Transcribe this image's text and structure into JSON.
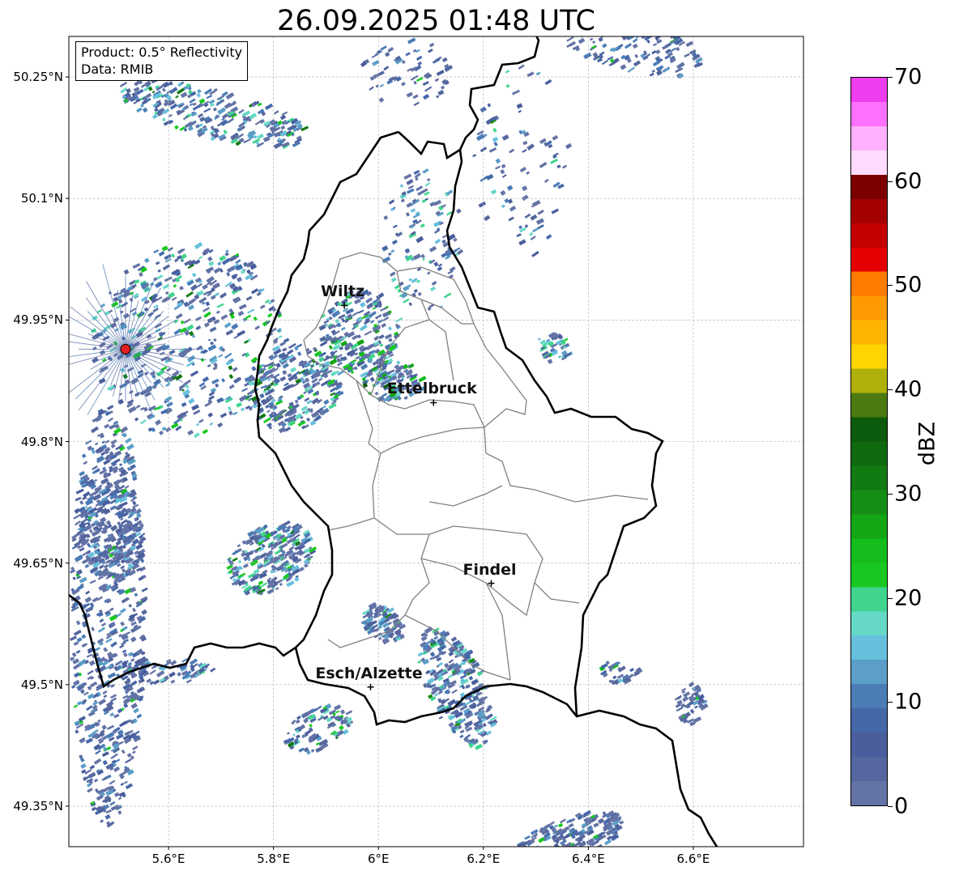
{
  "title": "26.09.2025 01:48 UTC",
  "info": {
    "product": "Product: 0.5° Reflectivity",
    "data": "Data: RMIB"
  },
  "y_ticks": [
    {
      "label": "50.25°N",
      "lat": 50.25
    },
    {
      "label": "50.1°N",
      "lat": 50.1
    },
    {
      "label": "49.95°N",
      "lat": 49.95
    },
    {
      "label": "49.8°N",
      "lat": 49.8
    },
    {
      "label": "49.65°N",
      "lat": 49.65
    },
    {
      "label": "49.5°N",
      "lat": 49.5
    },
    {
      "label": "49.35°N",
      "lat": 49.35
    }
  ],
  "x_ticks": [
    {
      "label": "5.6°E",
      "lon": 5.6
    },
    {
      "label": "5.8°E",
      "lon": 5.8
    },
    {
      "label": "6°E",
      "lon": 6.0
    },
    {
      "label": "6.2°E",
      "lon": 6.2
    },
    {
      "label": "6.4°E",
      "lon": 6.4
    },
    {
      "label": "6.6°E",
      "lon": 6.6
    }
  ],
  "extent": {
    "lon_min": 5.41,
    "lon_max": 6.81,
    "lat_min": 49.3,
    "lat_max": 50.3
  },
  "cities": [
    {
      "name": "Wiltz",
      "lon": 5.935,
      "lat": 49.968
    },
    {
      "name": "Ettelbruck",
      "lon": 6.105,
      "lat": 49.848
    },
    {
      "name": "Findel",
      "lon": 6.215,
      "lat": 49.625
    },
    {
      "name": "Esch/Alzette",
      "lon": 5.985,
      "lat": 49.497
    }
  ],
  "radar_site": {
    "lon": 5.518,
    "lat": 49.914,
    "color": "#e02020"
  },
  "colorbar": {
    "label": "dBZ",
    "min": 0,
    "max": 70,
    "ticks": [
      {
        "label": "0",
        "v": 0
      },
      {
        "label": "10",
        "v": 10
      },
      {
        "label": "20",
        "v": 20
      },
      {
        "label": "30",
        "v": 30
      },
      {
        "label": "40",
        "v": 40
      },
      {
        "label": "50",
        "v": 50
      },
      {
        "label": "60",
        "v": 60
      },
      {
        "label": "70",
        "v": 70
      }
    ],
    "colors": [
      "#6473a6",
      "#56679f",
      "#4a5e9d",
      "#4568a8",
      "#4b7cb6",
      "#5b9ec8",
      "#66c0dc",
      "#66d8c6",
      "#40d48e",
      "#18c820",
      "#14bc1c",
      "#14a614",
      "#148e14",
      "#127a12",
      "#0f6a0f",
      "#0c5a0c",
      "#4a7a10",
      "#b0b00a",
      "#ffd400",
      "#ffb400",
      "#ff9a00",
      "#ff7c00",
      "#e40000",
      "#c40000",
      "#a40000",
      "#7c0000",
      "#ffdcff",
      "#ffb0ff",
      "#ff70ff",
      "#ee3cee"
    ]
  }
}
